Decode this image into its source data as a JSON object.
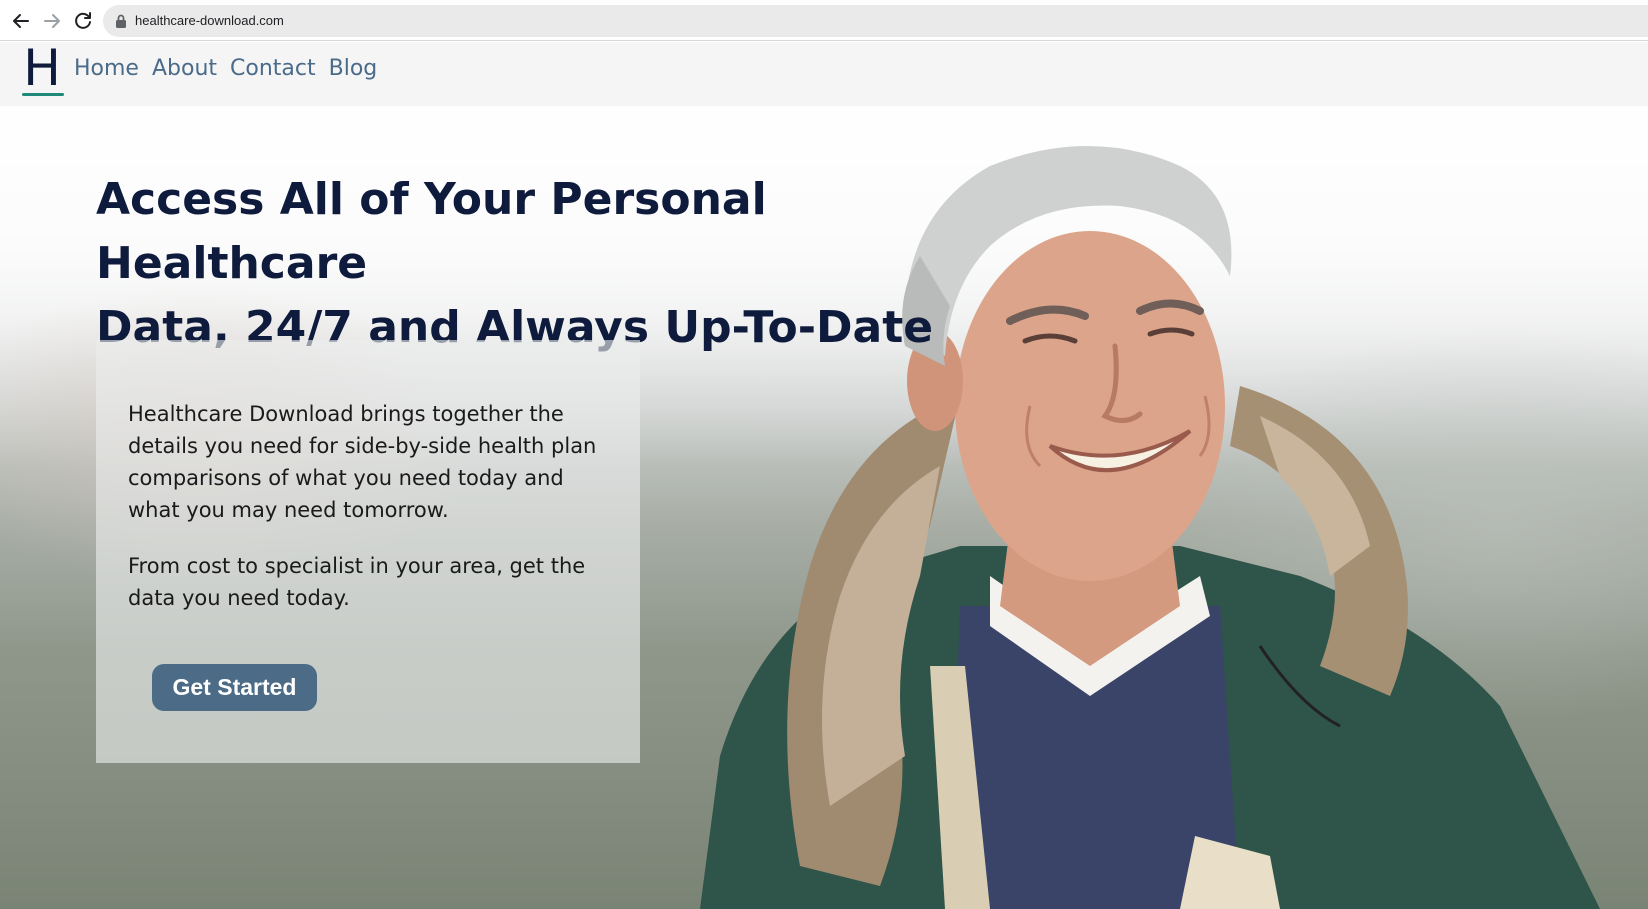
{
  "browser": {
    "url": "healthcare-download.com",
    "icons": [
      "back-arrow-icon",
      "forward-arrow-icon",
      "reload-icon",
      "lock-icon"
    ]
  },
  "header": {
    "logo_letter": "H",
    "nav": [
      {
        "label": "Home"
      },
      {
        "label": "About"
      },
      {
        "label": "Contact"
      },
      {
        "label": "Blog"
      }
    ]
  },
  "hero": {
    "title_line1": "Access All of Your Personal Healthcare",
    "title_line2": "Data, 24/7 and Always Up-To-Date",
    "paragraph1": "Healthcare Download brings together the details you need for side-by-side health plan comparisons of what you need today and what you may need tomorrow.",
    "paragraph2": "From cost to specialist in your area, get the data you need today.",
    "cta_label": "Get Started"
  },
  "colors": {
    "brand_navy": "#0e1b3c",
    "nav_link": "#4a6b8a",
    "cta_bg": "#4c6b87",
    "logo_accent": "#1f8a7a"
  }
}
